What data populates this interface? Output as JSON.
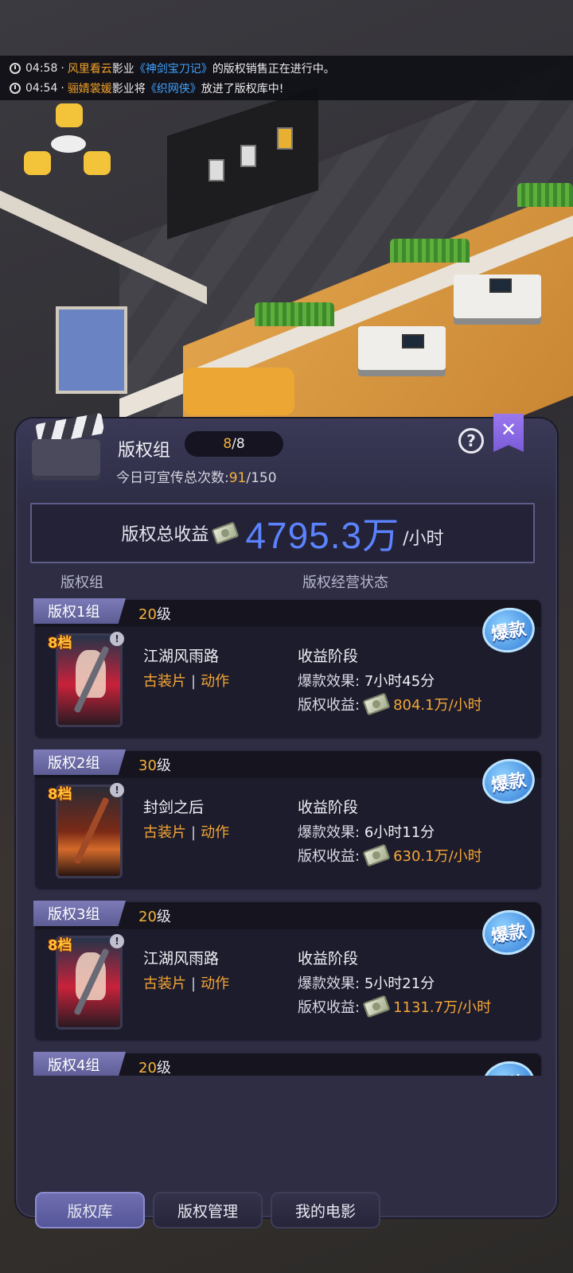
{
  "notifications": [
    {
      "time": "04:58",
      "dot": "·",
      "company": "风里看云",
      "pre": "影业",
      "movie": "《神剑宝刀记》",
      "post": "的版权销售正在进行中。"
    },
    {
      "time": "04:54",
      "dot": "·",
      "company": "骊婧裳媛",
      "pre": "影业将",
      "movie": "《织网侠》",
      "post": "放进了版权库中!"
    }
  ],
  "panel": {
    "title": "版权组",
    "slots_current": "8",
    "slots_rest": "/8",
    "promo_label": "今日可宣传总次数:",
    "promo_current": "91",
    "promo_rest": "/150",
    "help_icon": "?",
    "close_icon": "✕",
    "total_label": "版权总收益",
    "total_value": "4795.3万",
    "total_unit": "/小时",
    "col_group": "版权组",
    "col_status": "版权经营状态"
  },
  "cards": [
    {
      "group": "版权1组",
      "level_num": "20",
      "level_suffix": "级",
      "grade": "8档",
      "stars": "★★★★",
      "movie": "江湖风雨路",
      "genre1": "古装片",
      "sep": "|",
      "genre2": "动作",
      "stage": "收益阶段",
      "effect_label": "爆款效果:",
      "effect_value": "7小时45分",
      "income_label": "版权收益:",
      "income_value": "804.1万/小时",
      "badge": "爆款"
    },
    {
      "group": "版权2组",
      "level_num": "30",
      "level_suffix": "级",
      "grade": "8档",
      "stars": "★★★",
      "movie": "封剑之后",
      "genre1": "古装片",
      "sep": "|",
      "genre2": "动作",
      "stage": "收益阶段",
      "effect_label": "爆款效果:",
      "effect_value": "6小时11分",
      "income_label": "版权收益:",
      "income_value": "630.1万/小时",
      "badge": "爆款"
    },
    {
      "group": "版权3组",
      "level_num": "20",
      "level_suffix": "级",
      "grade": "8档",
      "stars": "★★★★",
      "movie": "江湖风雨路",
      "genre1": "古装片",
      "sep": "|",
      "genre2": "动作",
      "stage": "收益阶段",
      "effect_label": "爆款效果:",
      "effect_value": "5小时21分",
      "income_label": "版权收益:",
      "income_value": "1131.7万/小时",
      "badge": "爆款"
    },
    {
      "group": "版权4组",
      "level_num": "20",
      "level_suffix": "级",
      "badge": "爆款"
    }
  ],
  "tabs": [
    {
      "label": "版权库",
      "active": true
    },
    {
      "label": "版权管理",
      "active": false
    },
    {
      "label": "我的电影",
      "active": false
    }
  ],
  "colors": {
    "accent_orange": "#f5a636",
    "accent_blue": "#5c83ff",
    "panel_bg": "#2e2d44",
    "tag_purple": "#6d6ca8"
  }
}
